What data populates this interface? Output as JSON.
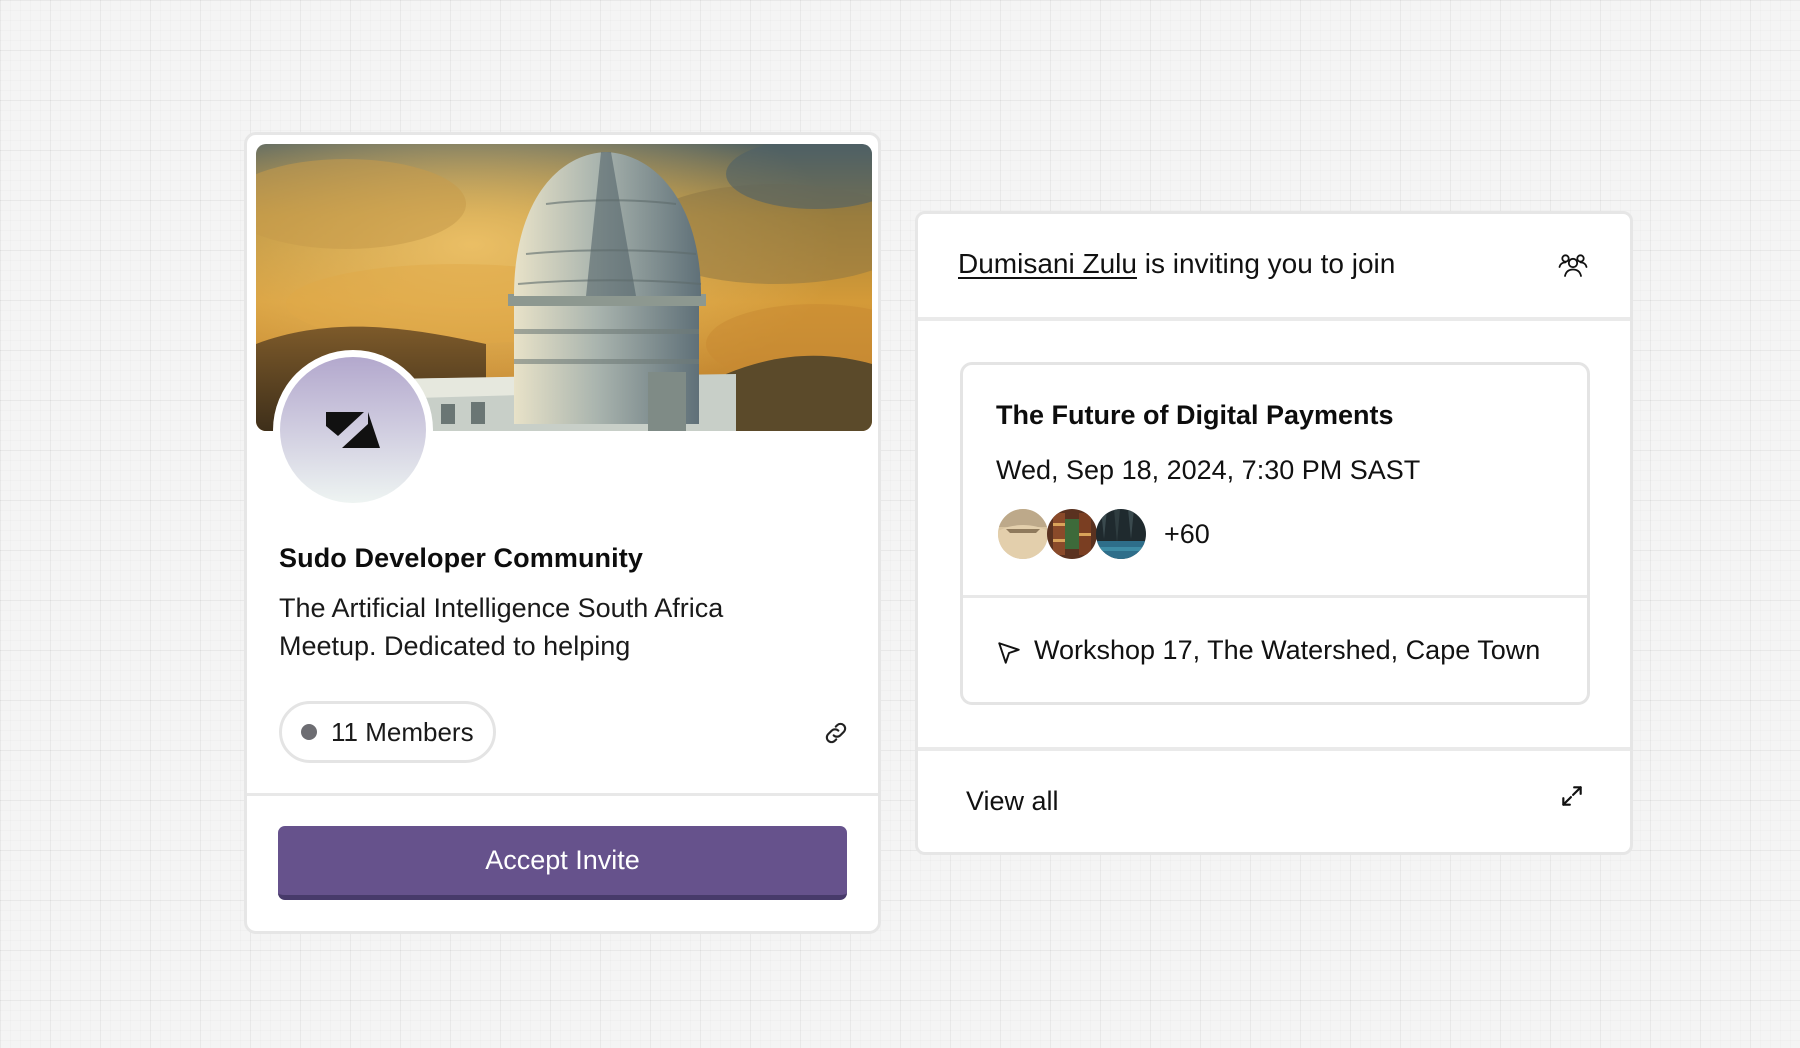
{
  "community": {
    "name": "Sudo Developer Community",
    "description": "The Artificial Intelligence South Africa Meetup. Dedicated to helping",
    "members_label": "11 Members",
    "accept_button": "Accept Invite",
    "cover_image": "observatory-dome-illustration",
    "logo_icon": "community-logo-icon",
    "share_icon": "link-icon"
  },
  "invite": {
    "inviter": "Dumisani Zulu",
    "message": "is inviting you to join",
    "header_icon": "people-group-icon",
    "event": {
      "title": "The Future of Digital Payments",
      "datetime": "Wed, Sep 18, 2024, 7:30 PM SAST",
      "attendee_more": "+60",
      "location_icon": "navigation-arrow-icon",
      "location": "Workshop 17, The Watershed, Cape Town"
    },
    "view_all": "View all",
    "view_all_icon": "expand-icon"
  },
  "colors": {
    "accent": "#66528c",
    "accent_border": "#473a6a",
    "card_border": "#e6e6e6",
    "background": "#f4f4f4"
  }
}
